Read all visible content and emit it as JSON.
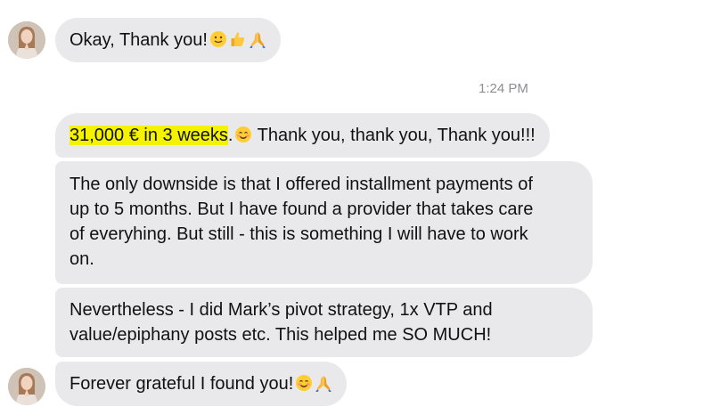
{
  "messages": [
    {
      "text": "Okay, Thank you!",
      "emojis": [
        "slightly-smiling-face",
        "thumbs-up",
        "folded-hands"
      ]
    },
    {
      "highlight": "31,000 € in 3 weeks",
      "text_after": ".",
      "text_rest": " Thank you, thank you, Thank you!!!",
      "emojis": [
        "smiling-face-with-smiling-eyes"
      ]
    },
    {
      "lines": [
        "The only downside is that I offered installment payments of",
        "up to 5 months. But I have found a provider that takes care",
        "of everyhing. But still - this is something I will have to work",
        "on."
      ]
    },
    {
      "lines": [
        "Nevertheless - I did Mark’s pivot strategy, 1x VTP and",
        "value/epiphany posts etc. This helped me SO MUCH!"
      ]
    },
    {
      "text": "Forever grateful I found you!",
      "emojis": [
        "smiling-face-with-smiling-eyes",
        "folded-hands"
      ]
    }
  ],
  "timestamp": "1:24 PM",
  "colors": {
    "bubble": "#e9e9eb",
    "highlight": "#f5f200",
    "timestamp": "#8e8e93"
  }
}
